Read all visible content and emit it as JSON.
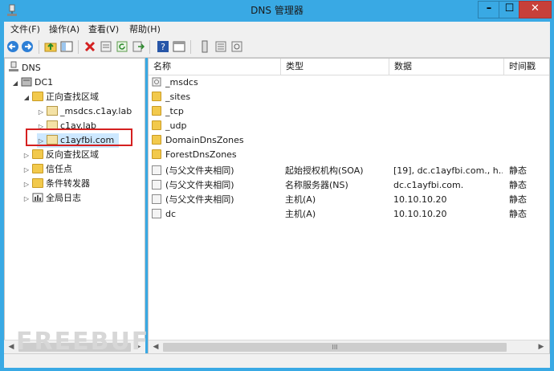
{
  "window": {
    "title": "DNS 管理器"
  },
  "menu": [
    "文件(F)",
    "操作(A)",
    "查看(V)",
    "帮助(H)"
  ],
  "toolbar": {
    "buttons": [
      "back-icon",
      "forward-icon",
      "up-folder-icon",
      "show-tree-icon",
      "delete-icon",
      "properties-icon",
      "refresh-icon",
      "export-icon",
      "help-icon",
      "console-icon",
      "server-icon",
      "list-icon",
      "update-icon"
    ]
  },
  "tree": {
    "root": "DNS",
    "server": "DC1",
    "forward": "正向查找区域",
    "zones": [
      "_msdcs.c1ay.lab",
      "c1ay.lab",
      "c1ayfbi.com"
    ],
    "reverse": "反向查找区域",
    "trust": "信任点",
    "conditional": "条件转发器",
    "logs": "全局日志"
  },
  "list": {
    "columns": [
      "名称",
      "类型",
      "数据",
      "时间戳"
    ],
    "folders": [
      "_msdcs",
      "_sites",
      "_tcp",
      "_udp",
      "DomainDnsZones",
      "ForestDnsZones"
    ],
    "records": [
      {
        "name": "(与父文件夹相同)",
        "type": "起始授权机构(SOA)",
        "data": "[19], dc.c1ayfbi.com., h...",
        "ts": "静态"
      },
      {
        "name": "(与父文件夹相同)",
        "type": "名称服务器(NS)",
        "data": "dc.c1ayfbi.com.",
        "ts": "静态"
      },
      {
        "name": "(与父文件夹相同)",
        "type": "主机(A)",
        "data": "10.10.10.20",
        "ts": "静态"
      },
      {
        "name": "dc",
        "type": "主机(A)",
        "data": "10.10.10.20",
        "ts": "静态"
      }
    ]
  },
  "scrollbar": {
    "grip": "III"
  },
  "watermark": "FREEBUF",
  "colors": {
    "titlebar": "#39a9e4",
    "close": "#c7403a",
    "selection": "#cde8ff",
    "highlight": "#d52020"
  }
}
